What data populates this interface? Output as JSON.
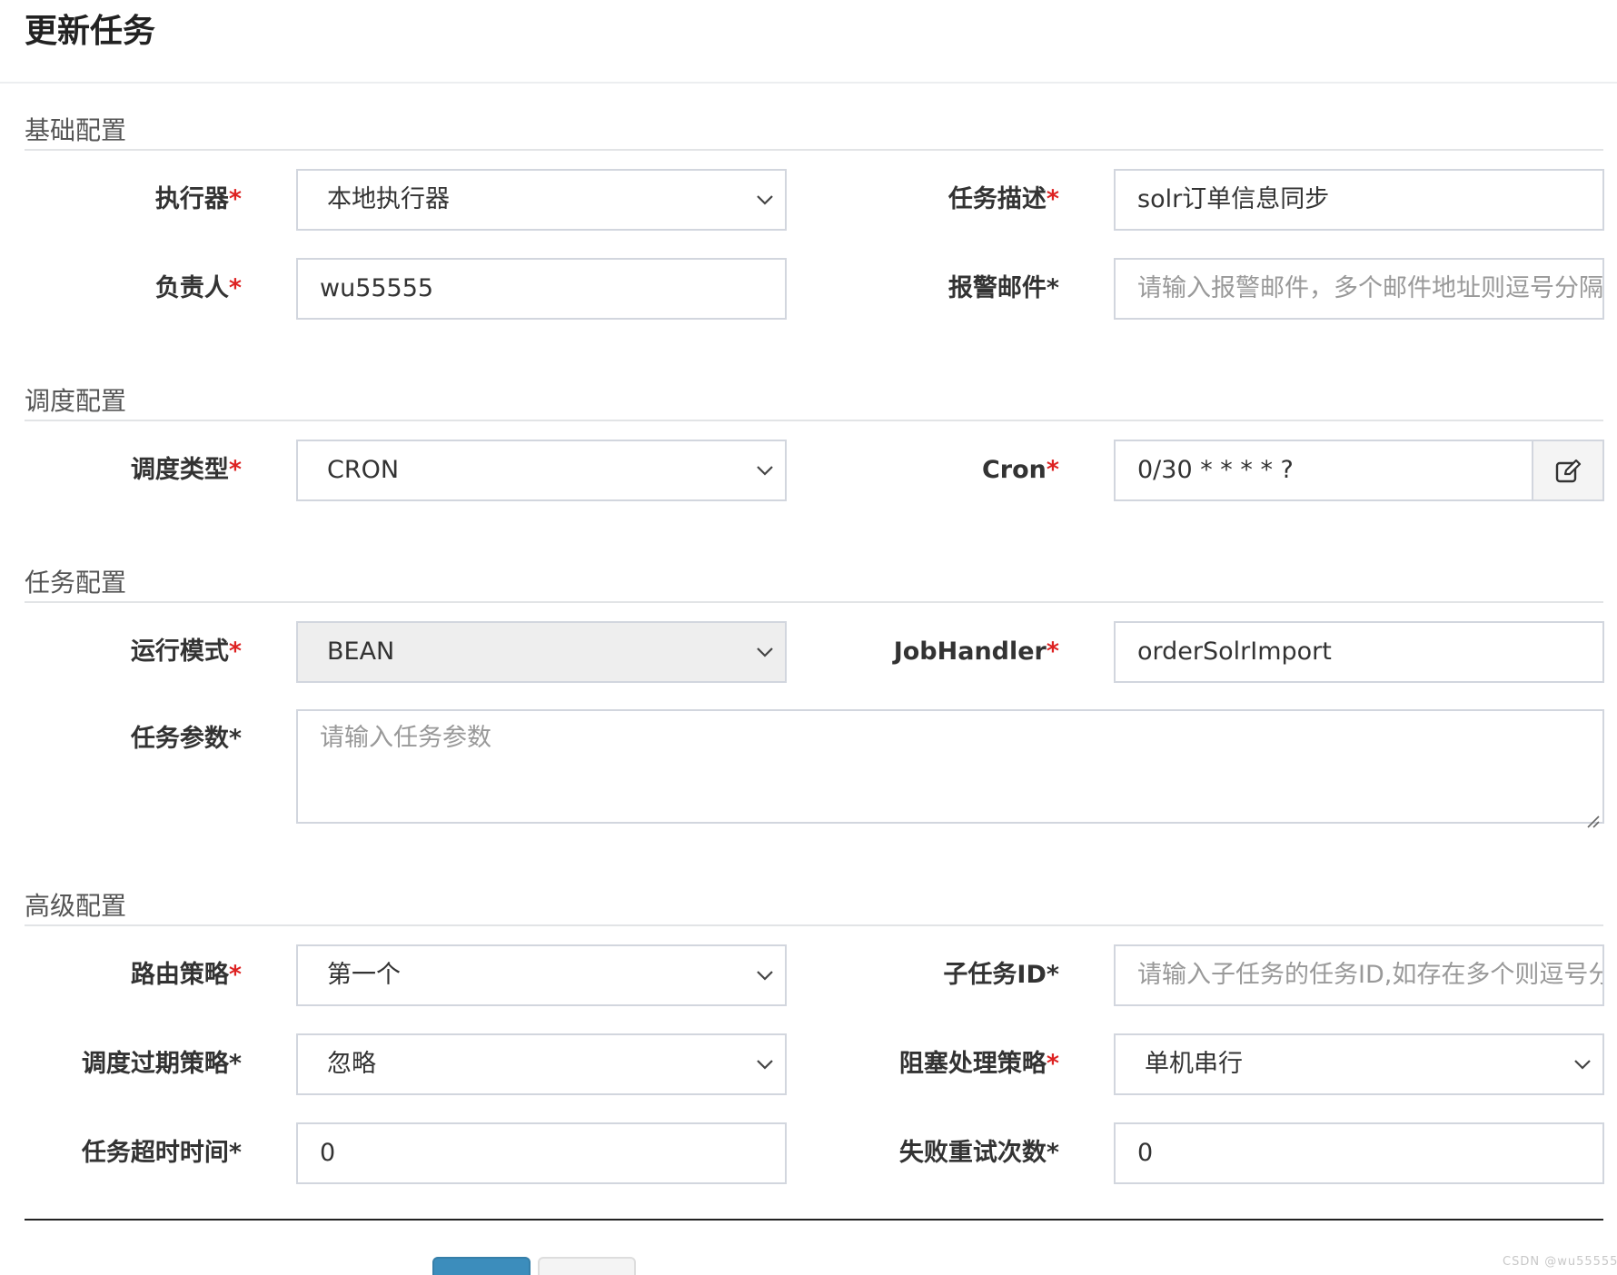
{
  "header": {
    "title": "更新任务"
  },
  "sections": {
    "basic": "基础配置",
    "schedule": "调度配置",
    "task": "任务配置",
    "advanced": "高级配置"
  },
  "form": {
    "executor": {
      "label": "执行器",
      "required_mark": "*",
      "value": "本地执行器"
    },
    "job_desc": {
      "label": "任务描述",
      "required_mark": "*",
      "value": "solr订单信息同步"
    },
    "author": {
      "label": "负责人",
      "required_mark": "*",
      "value": "wu55555"
    },
    "alarm_email": {
      "label": "报警邮件",
      "required_mark": "*",
      "placeholder": "请输入报警邮件，多个邮件地址则逗号分隔"
    },
    "schedule_type": {
      "label": "调度类型",
      "required_mark": "*",
      "value": "CRON"
    },
    "cron": {
      "label": "Cron",
      "required_mark": "*",
      "value": "0/30 * * * * ?"
    },
    "glue_type": {
      "label": "运行模式",
      "required_mark": "*",
      "value": "BEAN"
    },
    "job_handler": {
      "label": "JobHandler",
      "required_mark": "*",
      "value": "orderSolrImport"
    },
    "job_param": {
      "label": "任务参数",
      "required_mark": "*",
      "placeholder": "请输入任务参数"
    },
    "route_strategy": {
      "label": "路由策略",
      "required_mark": "*",
      "value": "第一个"
    },
    "child_job_id": {
      "label": "子任务ID",
      "required_mark": "*",
      "placeholder": "请输入子任务的任务ID,如存在多个则逗号分隔"
    },
    "misfire_strategy": {
      "label": "调度过期策略",
      "required_mark": "*",
      "value": "忽略"
    },
    "block_strategy": {
      "label": "阻塞处理策略",
      "required_mark": "*",
      "value": "单机串行"
    },
    "timeout": {
      "label": "任务超时时间",
      "required_mark": "*",
      "value": "0"
    },
    "fail_retry": {
      "label": "失败重试次数",
      "required_mark": "*",
      "value": "0"
    }
  },
  "watermark": "CSDN @wu55555",
  "icons": {
    "select_arrow": "chevron-down-icon",
    "cron_edit": "edit-icon"
  },
  "colors": {
    "required": "#dd2222",
    "primary_button": "#3c8dbc",
    "border": "#d2d6de",
    "disabled_bg": "#eeeeee"
  }
}
